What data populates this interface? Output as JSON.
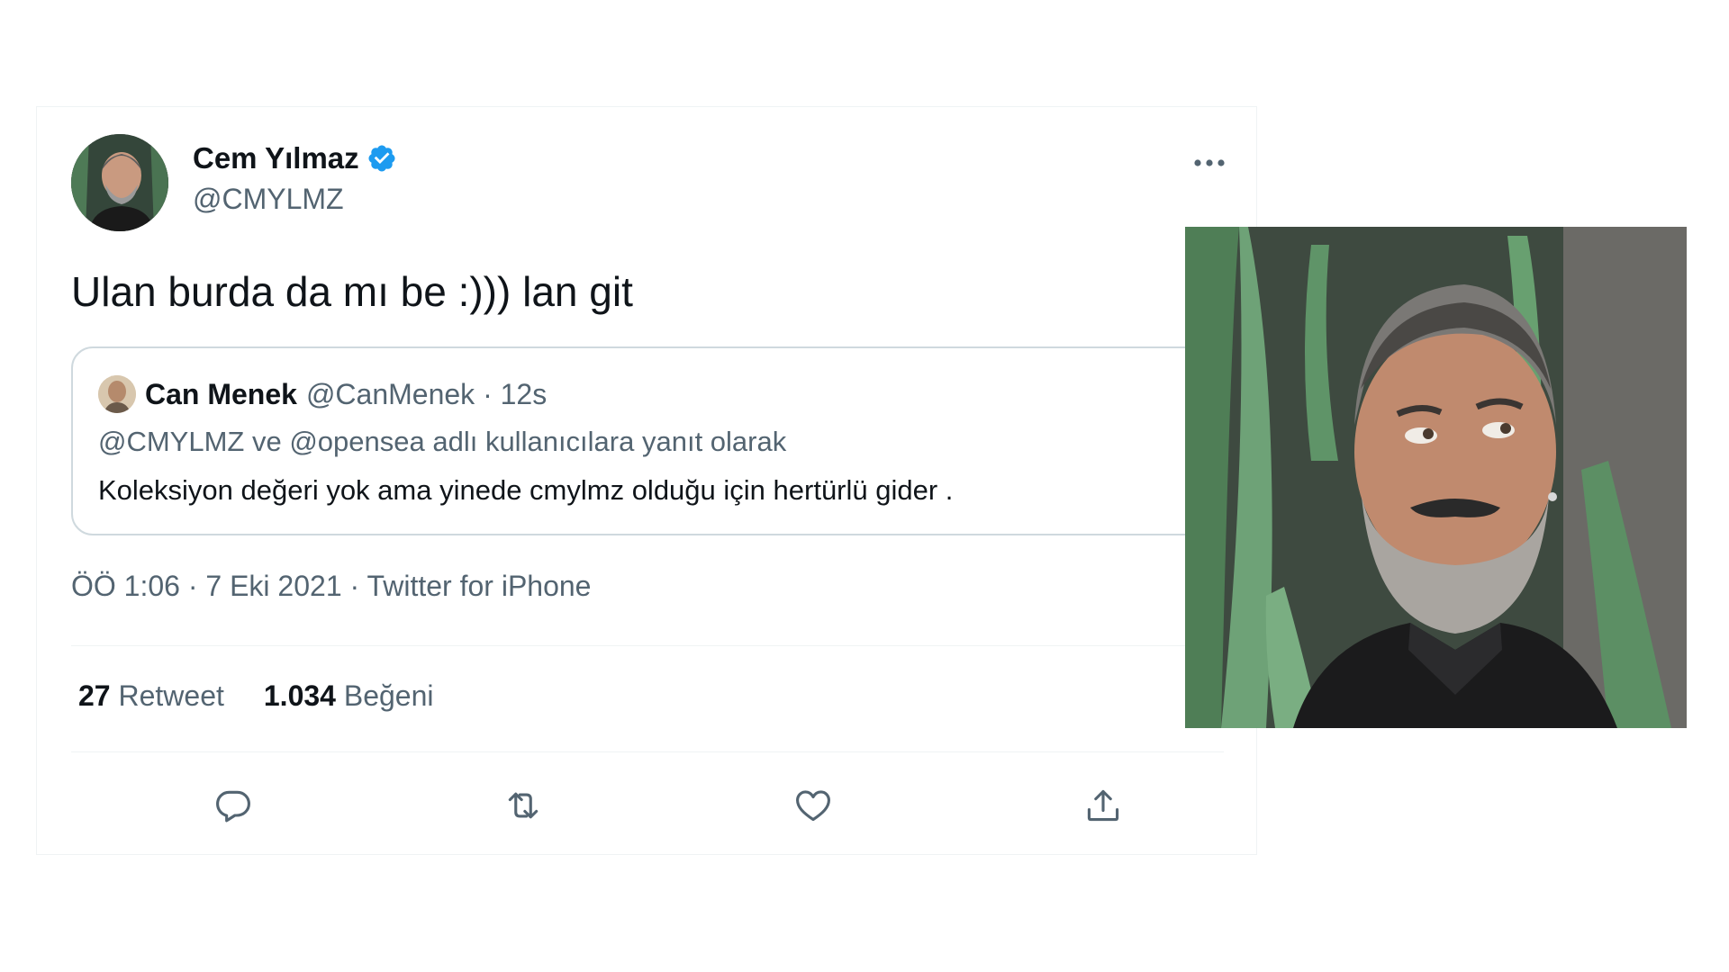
{
  "tweet": {
    "author_name": "Cem Yılmaz",
    "author_handle": "@CMYLMZ",
    "text": "Ulan burda da mı be :))) lan git",
    "timestamp": "ÖÖ 1:06 · 7 Eki 2021 · Twitter for iPhone",
    "retweet_count": "27",
    "retweet_label": "Retweet",
    "like_count": "1.034",
    "like_label": "Beğeni"
  },
  "quote": {
    "author_name": "Can Menek",
    "meta": "@CanMenek · 12s",
    "reply_line": "@CMYLMZ ve @opensea adlı kullanıcılara yanıt olarak",
    "body": "Koleksiyon değeri yok ama yinede cmylmz olduğu için hertürlü gider ."
  },
  "icons": {
    "verified": "verified-badge-icon",
    "more": "more-options-icon",
    "reply": "reply-icon",
    "retweet": "retweet-icon",
    "like": "heart-icon",
    "share": "share-icon"
  },
  "colors": {
    "accent": "#1d9bf0",
    "secondary_text": "#536471",
    "primary_text": "#0f1419",
    "border": "#cfd9de"
  }
}
